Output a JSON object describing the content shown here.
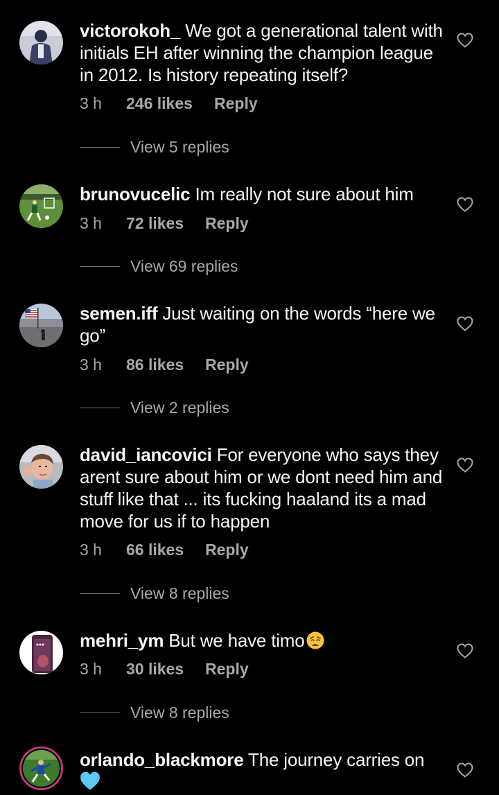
{
  "comments": [
    {
      "username": "victorokoh_",
      "text": "We got a generational talent with initials EH after winning the champion league in 2012. Is history repeating itself?",
      "time": "3 h",
      "likes": "246 likes",
      "reply": "Reply",
      "view_replies": "View 5 replies",
      "avatar_icon": "person-photo-avatar"
    },
    {
      "username": "brunovucelic",
      "text": "Im really not sure about him",
      "time": "3 h",
      "likes": "72 likes",
      "reply": "Reply",
      "view_replies": "View 69 replies",
      "avatar_icon": "football-pitch-avatar"
    },
    {
      "username": "semen.iff",
      "text": "Just waiting on the words “here we go”",
      "time": "3 h",
      "likes": "86 likes",
      "reply": "Reply",
      "view_replies": "View 2 replies",
      "avatar_icon": "street-flag-avatar"
    },
    {
      "username": "david_iancovici",
      "text": "For everyone who says they arent sure about him or we dont need him and stuff like that ... its fucking haaland its a mad move for us if to happen",
      "time": "3 h",
      "likes": "66 likes",
      "reply": "Reply",
      "view_replies": "View 8 replies",
      "avatar_icon": "selfie-avatar"
    },
    {
      "username": "mehri_ym",
      "text": "But we have timo",
      "emoji": "weary-face-emoji",
      "time": "3 h",
      "likes": "30 likes",
      "reply": "Reply",
      "view_replies": "View 8 replies",
      "avatar_icon": "phone-screen-avatar"
    },
    {
      "username": "orlando_blackmore",
      "text": "The journey carries on",
      "emoji": "blue-heart-emoji",
      "avatar_icon": "player-story-avatar"
    }
  ],
  "icons": {
    "like": "heart-outline-icon"
  },
  "colors": {
    "background": "#000000",
    "primary_text": "#f5f5f5",
    "secondary_text": "#a8a8a8",
    "story_ring": "#c13584",
    "blue_heart": "#5bc8f5"
  }
}
